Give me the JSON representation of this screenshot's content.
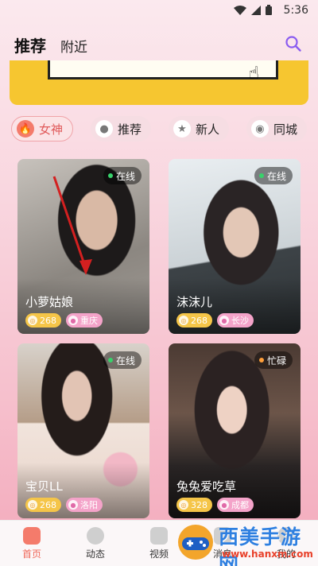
{
  "status_bar": {
    "time": "5:36"
  },
  "top_nav": {
    "tab_recommend": "推荐",
    "tab_nearby": "附近"
  },
  "categories": [
    {
      "label": "女神",
      "icon": "flame-icon"
    },
    {
      "label": "推荐",
      "icon": "flame-icon"
    },
    {
      "label": "新人",
      "icon": "star-icon"
    },
    {
      "label": "同城",
      "icon": "location-icon"
    }
  ],
  "cards": [
    {
      "name": "小萝姑娘",
      "status": "在线",
      "heat": "268",
      "city": "重庆"
    },
    {
      "name": "沫沫儿",
      "status": "在线",
      "heat": "268",
      "city": "长沙"
    },
    {
      "name": "宝贝LL",
      "status": "在线",
      "heat": "268",
      "city": "洛阳"
    },
    {
      "name": "兔兔爱吃草",
      "status": "忙碌",
      "heat": "328",
      "city": "成都"
    }
  ],
  "tab_bar": [
    {
      "label": "首页"
    },
    {
      "label": "动态"
    },
    {
      "label": "视频"
    },
    {
      "label": "消息"
    },
    {
      "label": "我的"
    }
  ],
  "watermark": {
    "text": "西美手游网",
    "url": "www.hanxm.com"
  },
  "colors": {
    "accent": "#f47b6b",
    "banner": "#f6c630",
    "online": "#38d26b",
    "busy": "#ff9f3a"
  }
}
